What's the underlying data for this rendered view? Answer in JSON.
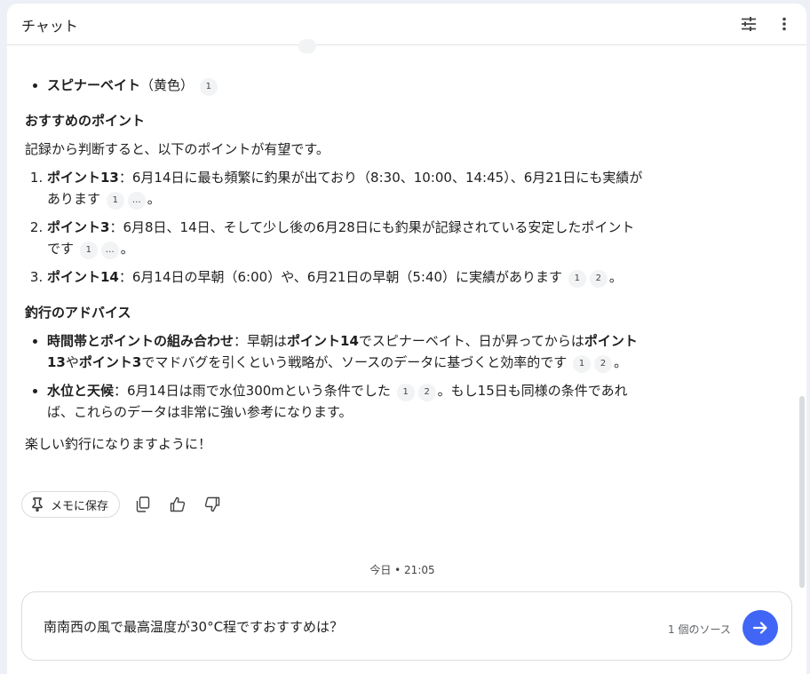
{
  "header": {
    "title": "チャット"
  },
  "top_bullet": {
    "label": "スピナーベイト",
    "suffix": "（黄色）",
    "cite": "1"
  },
  "section1": {
    "heading": "おすすめのポイント",
    "intro": "記録から判断すると、以下のポイントが有望です。",
    "items": [
      {
        "bold": "ポイント13",
        "text": "：6月14日に最も頻繁に釣果が出ており（8:30、10:00、14:45）、6月21日にも実績があります",
        "cites": [
          "1",
          "…"
        ],
        "end": "。"
      },
      {
        "bold": "ポイント3",
        "text": "：6月8日、14日、そして少し後の6月28日にも釣果が記録されている安定したポイントです",
        "cites": [
          "1",
          "…"
        ],
        "end": "。"
      },
      {
        "bold": "ポイント14",
        "text": "：6月14日の早朝（6:00）や、6月21日の早朝（5:40）に実績があります",
        "cites": [
          "1",
          "2"
        ],
        "end": "。"
      }
    ]
  },
  "section2": {
    "heading": "釣行のアドバイス",
    "item1": {
      "bold1": "時間帯とポイントの組み合わせ",
      "t1": "：早朝は",
      "bold2": "ポイント14",
      "t2": "でスピナーベイト、日が昇ってからは",
      "bold3": "ポイント13",
      "t3": "や",
      "bold4": "ポイント3",
      "t4": "でマドバグを引くという戦略が、ソースのデータに基づくと効率的です",
      "cites": [
        "1",
        "2"
      ],
      "end": "。"
    },
    "item2": {
      "bold": "水位と天候",
      "t1": "：6月14日は雨で水位300mという条件でした",
      "cites": [
        "1",
        "2"
      ],
      "t2": "。もし15日も同様の条件であれば、これらのデータは非常に強い参考になります。"
    }
  },
  "closing": "楽しい釣行になりますように！",
  "actions": {
    "save_label": "メモに保存"
  },
  "timestamp": "今日 • 21:05",
  "composer": {
    "value": "南南西の風で最高温度が30°C程ですおすすめは？",
    "source_count": "1 個のソース"
  }
}
